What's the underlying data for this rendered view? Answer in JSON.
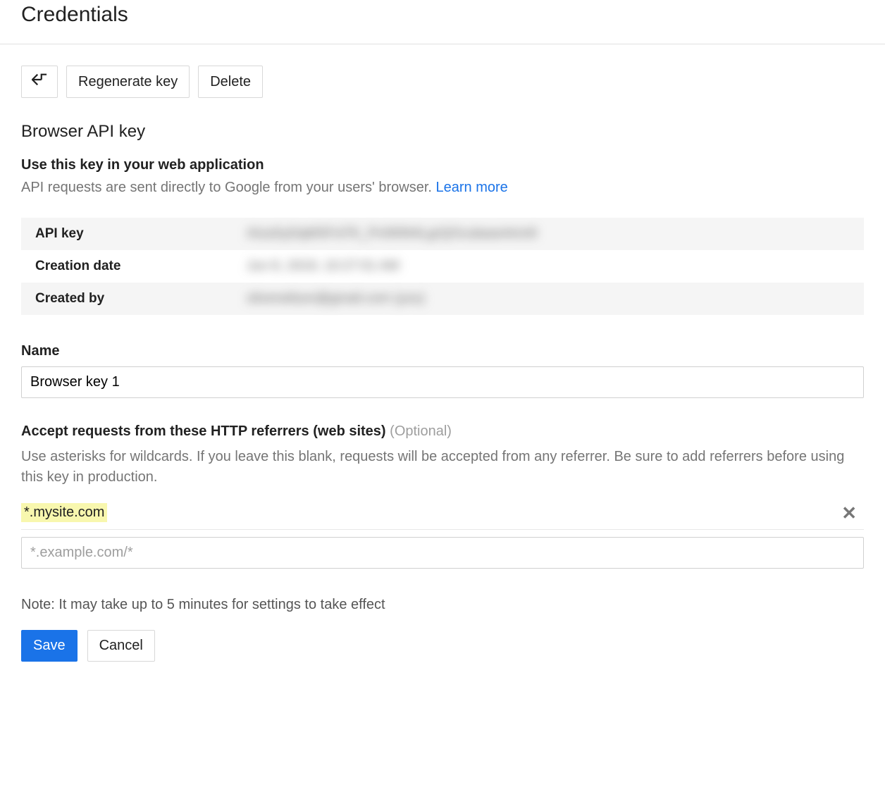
{
  "header": {
    "title": "Credentials"
  },
  "toolbar": {
    "regenerate_label": "Regenerate key",
    "delete_label": "Delete"
  },
  "section": {
    "heading": "Browser API key",
    "sub_heading": "Use this key in your web application",
    "helper_text": "API requests are sent directly to Google from your users' browser.",
    "learn_more": "Learn more"
  },
  "info": {
    "api_key_label": "API key",
    "api_key_value": "AIzaSyDqMSFxl7K_PvIWW4LgrQOcubase4nm9",
    "creation_date_label": "Creation date",
    "creation_date_value": "Jun 8, 2019, 10:27:01 AM",
    "created_by_label": "Created by",
    "created_by_value": "oliverwilson@gmail.com (you)"
  },
  "name_field": {
    "label": "Name",
    "value": "Browser key 1"
  },
  "referrers": {
    "label": "Accept requests from these HTTP referrers (web sites)",
    "optional": "(Optional)",
    "helper": "Use asterisks for wildcards. If you leave this blank, requests will be accepted from any referrer. Be sure to add referrers before using this key in production.",
    "items": [
      "*.mysite.com"
    ],
    "placeholder": "*.example.com/*"
  },
  "note": "Note: It may take up to 5 minutes for settings to take effect",
  "buttons": {
    "save": "Save",
    "cancel": "Cancel"
  }
}
